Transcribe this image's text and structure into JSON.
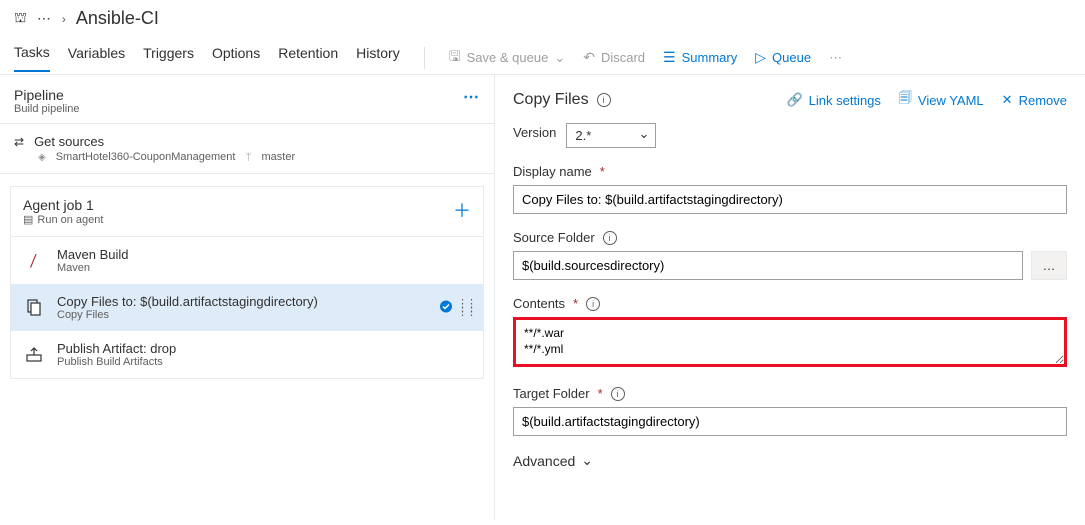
{
  "breadcrumb": {
    "title": "Ansible-CI"
  },
  "tabs": [
    "Tasks",
    "Variables",
    "Triggers",
    "Options",
    "Retention",
    "History"
  ],
  "toolbar": {
    "save_queue": "Save & queue",
    "discard": "Discard",
    "summary": "Summary",
    "queue": "Queue"
  },
  "pipeline": {
    "title": "Pipeline",
    "subtitle": "Build pipeline"
  },
  "get_sources": {
    "title": "Get sources",
    "repo": "SmartHotel360-CouponManagement",
    "branch": "master"
  },
  "agent_job": {
    "title": "Agent job 1",
    "subtitle": "Run on agent"
  },
  "tasks_list": [
    {
      "title": "Maven Build",
      "subtitle": "Maven",
      "icon": "feather"
    },
    {
      "title": "Copy Files to: $(build.artifactstagingdirectory)",
      "subtitle": "Copy Files",
      "icon": "copy",
      "selected": true
    },
    {
      "title": "Publish Artifact: drop",
      "subtitle": "Publish Build Artifacts",
      "icon": "publish"
    }
  ],
  "detail": {
    "section_title": "Copy Files",
    "link_settings": "Link settings",
    "view_yaml": "View YAML",
    "remove": "Remove",
    "version_label": "Version",
    "version_value": "2.*",
    "display_name_label": "Display name",
    "display_name_value": "Copy Files to: $(build.artifactstagingdirectory)",
    "source_folder_label": "Source Folder",
    "source_folder_value": "$(build.sourcesdirectory)",
    "contents_label": "Contents",
    "contents_value": "**/*.war\n**/*.yml",
    "target_folder_label": "Target Folder",
    "target_folder_value": "$(build.artifactstagingdirectory)",
    "advanced": "Advanced"
  }
}
